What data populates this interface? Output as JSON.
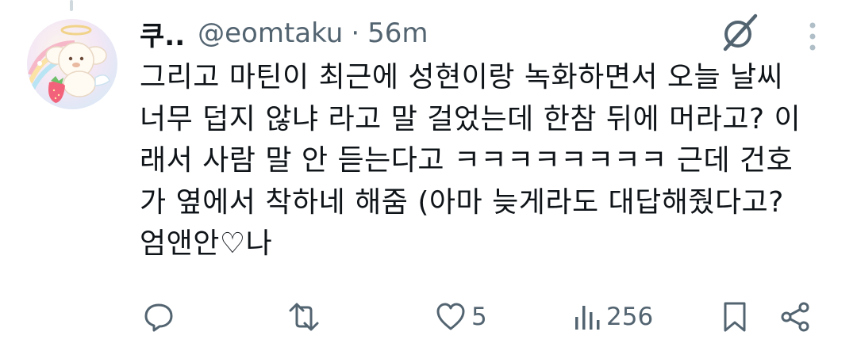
{
  "post": {
    "display_name": "쿠..",
    "handle": "@eomtaku",
    "separator": "·",
    "time": "56m",
    "text": "그리고 마틴이 최근에 성현이랑 녹화하면서 오늘 날씨\n너무 덥지 않냐 라고 말 걸었는데 한참 뒤에 머라고? 이\n래서 사람 말 안 듣는다고 ㅋㅋㅋㅋㅋㅋㅋㅋ 근데 건호\n가 옆에서 착하네 해줌 (아마 늦게라도 대답해줬다고?\n엄앤안♡나"
  },
  "actions": {
    "reply": {
      "icon": "reply-icon"
    },
    "repost": {
      "icon": "repost-icon"
    },
    "like": {
      "icon": "heart-icon",
      "count": "5"
    },
    "views": {
      "icon": "views-icon",
      "count": "256"
    },
    "bookmark": {
      "icon": "bookmark-icon"
    },
    "share": {
      "icon": "share-icon"
    }
  },
  "colors": {
    "text": "#0f1419",
    "secondary": "#536471",
    "thread_line": "#cfd9de"
  }
}
